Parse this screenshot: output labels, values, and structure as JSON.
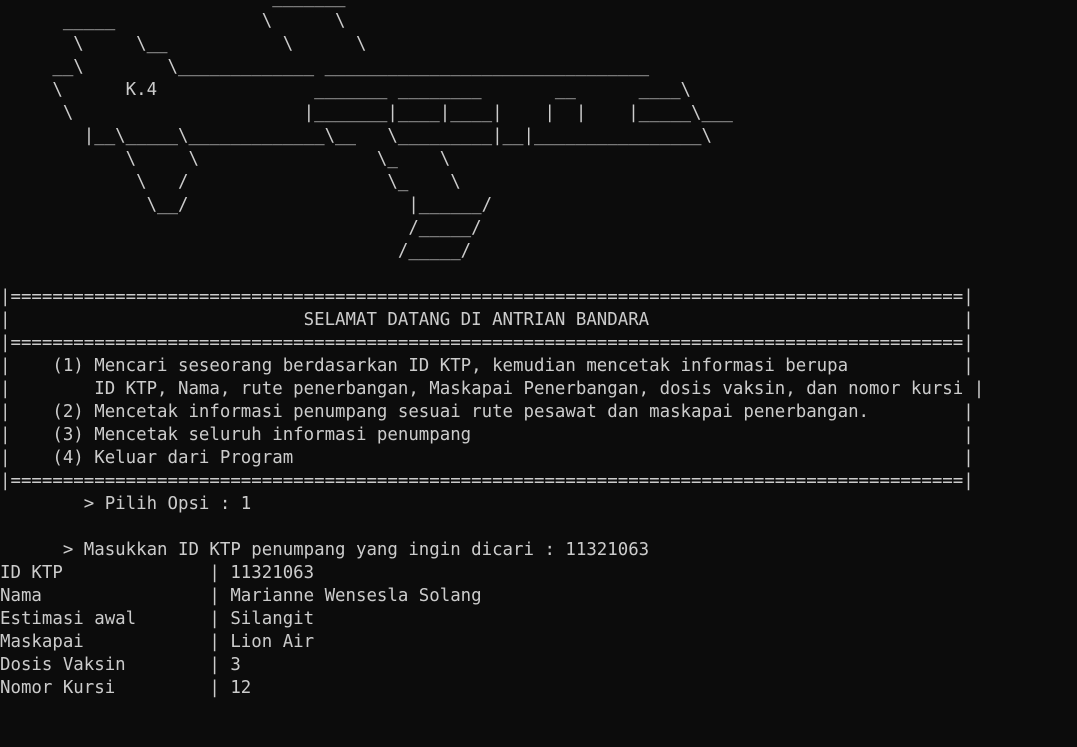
{
  "terminal": {
    "ascii_art": [
      "                          _______",
      "      _____              \\      \\",
      "       \\     \\__           \\      \\",
      "     __\\        \\_____________ _______________________________",
      "     \\      K.4               _______ ________       __      ____\\",
      "      \\                      |_______|____|____|    |  |    |_____\\___",
      "        |__\\_____\\_____________\\__   \\_________|__|________________\\",
      "            \\     \\                 \\_    \\",
      "             \\   /                   \\_    \\",
      "              \\__/                     |______/",
      "                                       /_____/",
      "                                      /_____/",
      ""
    ],
    "menu": {
      "border_line": "|===========================================================================================|",
      "title_line": "|                            SELAMAT DATANG DI ANTRIAN BANDARA                              |",
      "options": [
        "|    (1) Mencari seseorang berdasarkan ID KTP, kemudian mencetak informasi berupa           |",
        "|        ID KTP, Nama, rute penerbangan, Maskapai Penerbangan, dosis vaksin, dan nomor kursi |",
        "|    (2) Mencetak informasi penumpang sesuai rute pesawat dan maskapai penerbangan.         |",
        "|    (3) Mencetak seluruh informasi penumpang                                               |",
        "|    (4) Keluar dari Program                                                                |"
      ]
    },
    "prompt_option": "        > Pilih Opsi : 1",
    "blank_line": "",
    "prompt_search": "      > Masukkan ID KTP penumpang yang ingin dicari : 11321063",
    "result_rows": [
      "ID KTP              | 11321063",
      "Nama                | Marianne Wensesla Solang",
      "Estimasi awal       | Silangit",
      "Maskapai            | Lion Air",
      "Dosis Vaksin        | 3",
      "Nomor Kursi         | 12"
    ]
  }
}
